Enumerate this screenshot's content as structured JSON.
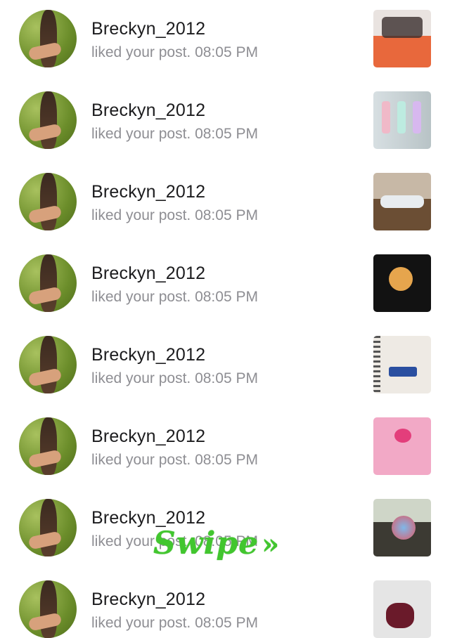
{
  "notifications": [
    {
      "username": "Breckyn_2012",
      "text": "liked your post. 08:05 PM",
      "thumbnail": "cup-photo"
    },
    {
      "username": "Breckyn_2012",
      "text": "liked your post. 08:05 PM",
      "thumbnail": "spray-bottles-photo"
    },
    {
      "username": "Breckyn_2012",
      "text": "liked your post. 08:05 PM",
      "thumbnail": "sneakers-photo"
    },
    {
      "username": "Breckyn_2012",
      "text": "liked your post. 08:05 PM",
      "thumbnail": "candle-photo"
    },
    {
      "username": "Breckyn_2012",
      "text": "liked your post. 08:05 PM",
      "thumbnail": "notebook-photo"
    },
    {
      "username": "Breckyn_2012",
      "text": "liked your post. 08:05 PM",
      "thumbnail": "pink-graphic"
    },
    {
      "username": "Breckyn_2012",
      "text": "liked your post. 08:05 PM",
      "thumbnail": "shaved-ice-photo"
    },
    {
      "username": "Breckyn_2012",
      "text": "liked your post. 08:05 PM",
      "thumbnail": "flower-photo"
    }
  ],
  "overlay": {
    "swipe_label": "Swipe",
    "arrows": "»"
  },
  "colors": {
    "username": "#1c1c1e",
    "subtext": "#8e8e93",
    "swipe": "#42c62f"
  }
}
